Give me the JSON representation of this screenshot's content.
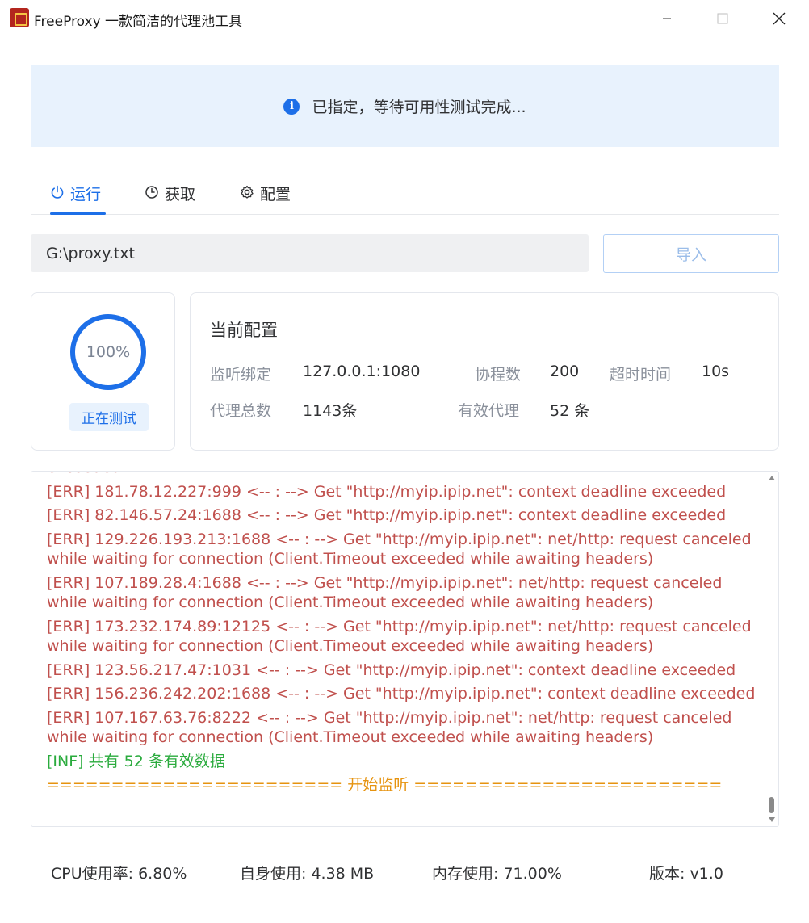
{
  "window": {
    "title": "FreeProxy 一款简洁的代理池工具"
  },
  "alert": {
    "icon": "info-icon",
    "message": "已指定，等待可用性测试完成..."
  },
  "tabs": [
    {
      "label": "运行",
      "icon": "power-icon",
      "active": true
    },
    {
      "label": "获取",
      "icon": "clock-icon",
      "active": false
    },
    {
      "label": "配置",
      "icon": "gear-icon",
      "active": false
    }
  ],
  "file": {
    "path": "G:\\proxy.txt",
    "import_label": "导入"
  },
  "progress": {
    "percent_text": "100%",
    "fraction": 1.0,
    "status": "正在测试"
  },
  "config": {
    "title": "当前配置",
    "listen_label": "监听绑定",
    "listen_value": "127.0.0.1:1080",
    "coroutines_label": "协程数",
    "coroutines_value": "200",
    "timeout_label": "超时时间",
    "timeout_value": "10s",
    "total_label": "代理总数",
    "total_value": "1143条",
    "valid_label": "有效代理",
    "valid_value": "52 条"
  },
  "log": [
    {
      "level": "err",
      "text": "exceeded"
    },
    {
      "level": "err",
      "text": "[ERR] 181.78.12.227:999 <-- : --> Get \"http://myip.ipip.net\": context deadline exceeded"
    },
    {
      "level": "err",
      "text": "[ERR] 82.146.57.24:1688 <-- : --> Get \"http://myip.ipip.net\": context deadline exceeded"
    },
    {
      "level": "err",
      "text": "[ERR] 129.226.193.213:1688 <-- : --> Get \"http://myip.ipip.net\": net/http: request canceled while waiting for connection (Client.Timeout exceeded while awaiting headers)"
    },
    {
      "level": "err",
      "text": "[ERR] 107.189.28.4:1688 <-- : --> Get \"http://myip.ipip.net\": net/http: request canceled while waiting for connection (Client.Timeout exceeded while awaiting headers)"
    },
    {
      "level": "err",
      "text": "[ERR] 173.232.174.89:12125 <-- : --> Get \"http://myip.ipip.net\": net/http: request canceled while waiting for connection (Client.Timeout exceeded while awaiting headers)"
    },
    {
      "level": "err",
      "text": "[ERR] 123.56.217.47:1031 <-- : --> Get \"http://myip.ipip.net\": context deadline exceeded"
    },
    {
      "level": "err",
      "text": "[ERR] 156.236.242.202:1688 <-- : --> Get \"http://myip.ipip.net\": context deadline exceeded"
    },
    {
      "level": "err",
      "text": "[ERR] 107.167.63.76:8222 <-- : --> Get \"http://myip.ipip.net\": net/http: request canceled while waiting for connection (Client.Timeout exceeded while awaiting headers)"
    },
    {
      "level": "inf",
      "text": "[INF] 共有 52 条有效数据"
    },
    {
      "level": "warn",
      "text": "======================= 开始监听 ========================"
    }
  ],
  "footer": {
    "cpu": "CPU使用率: 6.80%",
    "self_usage": "自身使用: 4.38 MB",
    "memory": "内存使用: 71.00%",
    "version": "版本: v1.0"
  },
  "colors": {
    "accent": "#1d6fe8",
    "error_text": "#c0504d",
    "info_text": "#2aab3d",
    "warn_text": "#e6930f",
    "alert_bg": "#e8f2fd"
  }
}
